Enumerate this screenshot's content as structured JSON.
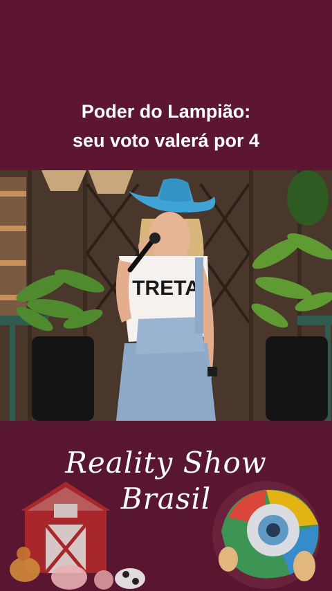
{
  "caption": {
    "line1": "Poder do Lampião:",
    "line2": "seu voto valerá por 4"
  },
  "video": {
    "shirt_text": "TRETA"
  },
  "logo": {
    "line1": "Reality Show",
    "line2": "Brasil"
  },
  "colors": {
    "background": "#5c1633",
    "hat": "#3fa3d6",
    "caption_text": "#ffffff"
  }
}
